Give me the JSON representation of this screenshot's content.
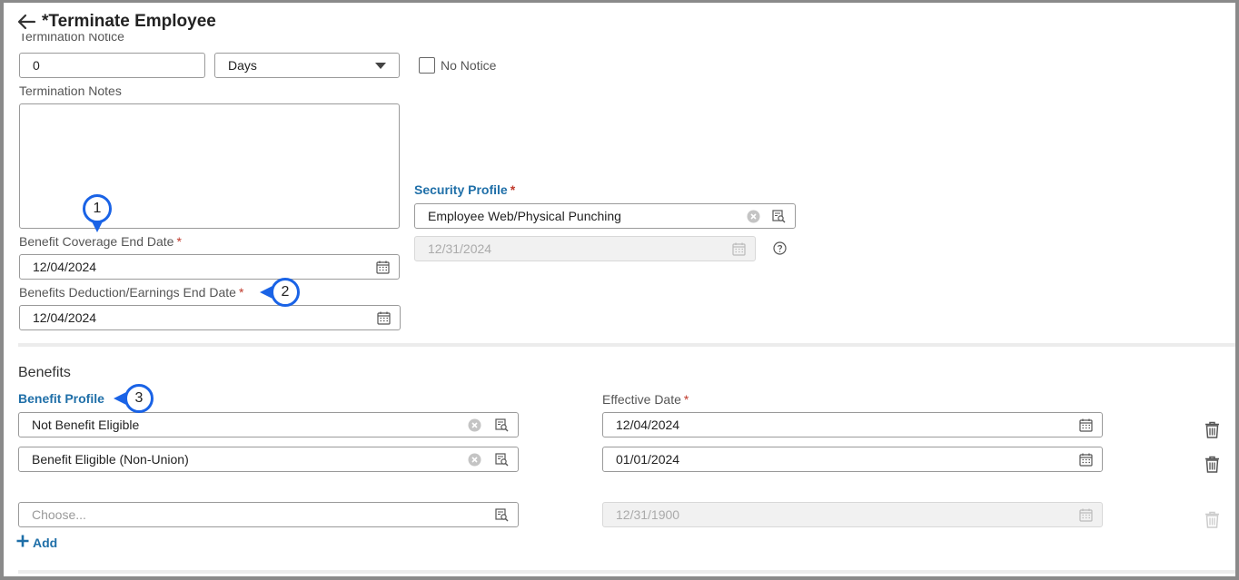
{
  "header": {
    "title": "*Terminate Employee"
  },
  "termination_notice": {
    "label": "Termination Notice",
    "value": "0",
    "unit": "Days",
    "no_notice_label": "No Notice"
  },
  "termination_notes": {
    "label": "Termination Notes"
  },
  "security_profile": {
    "label": "Security Profile",
    "value": "Employee Web/Physical Punching",
    "date": "12/31/2024"
  },
  "benefit_coverage_end": {
    "label": "Benefit Coverage End Date",
    "value": "12/04/2024"
  },
  "benefits_deduction_end": {
    "label": "Benefits Deduction/Earnings End Date",
    "value": "12/04/2024"
  },
  "benefits": {
    "section_title": "Benefits",
    "profile_label": "Benefit Profile",
    "effective_label": "Effective Date",
    "rows": [
      {
        "profile": "Not Benefit Eligible",
        "date": "12/04/2024"
      },
      {
        "profile": "Benefit Eligible (Non-Union)",
        "date": "01/01/2024"
      },
      {
        "profile": "Choose...",
        "date": "12/31/1900"
      }
    ],
    "add_label": "Add"
  },
  "callouts": [
    "1",
    "2",
    "3"
  ],
  "colors": {
    "accent": "#1f6fa8",
    "callout": "#1a63e6",
    "required": "#c0392b"
  }
}
